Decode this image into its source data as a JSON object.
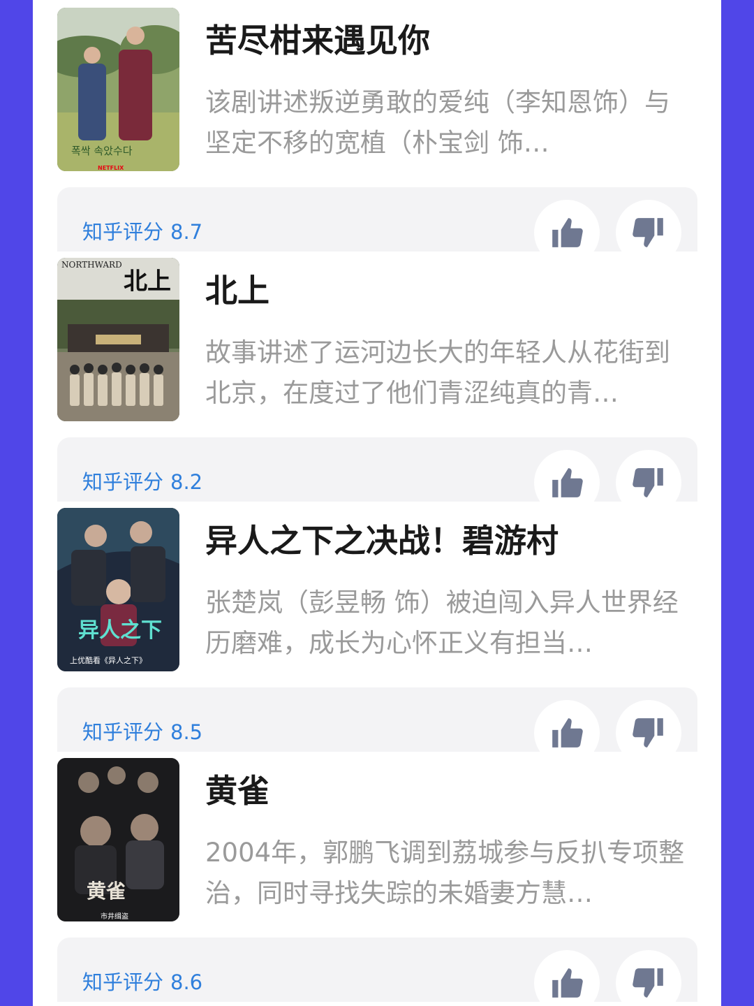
{
  "colors": {
    "background": "#5046e8",
    "panel": "#ffffff",
    "rating": "#2f7fdc",
    "vote_icon": "#6f7891"
  },
  "icons": {
    "upvote": "thumbs-up-icon",
    "downvote": "thumbs-down-icon"
  },
  "items": [
    {
      "title": "苦尽柑来遇见你",
      "description": "该剧讲述叛逆勇敢的爱纯（李知恩饰）与坚定不移的宽植（朴宝剑 饰…",
      "rating_label": "知乎评分",
      "rating_value": "8.7",
      "poster_text": "폭싹 속았수다",
      "poster_badge": "NETFLIX"
    },
    {
      "title": "北上",
      "description": "故事讲述了运河边长大的年轻人从花街到北京，在度过了他们青涩纯真的青…",
      "rating_label": "知乎评分",
      "rating_value": "8.2",
      "poster_text": "北上",
      "poster_badge": "NORTHWARD"
    },
    {
      "title": "异人之下之决战！碧游村",
      "description": "张楚岚（彭昱畅 饰）被迫闯入异人世界经历磨难，成长为心怀正义有担当…",
      "rating_label": "知乎评分",
      "rating_value": "8.5",
      "poster_text": "异人之下",
      "poster_badge": "上优酷看《异人之下》"
    },
    {
      "title": "黄雀",
      "description": "2004年，郭鹏飞调到荔城参与反扒专项整治，同时寻找失踪的未婚妻方慧…",
      "rating_label": "知乎评分",
      "rating_value": "8.6",
      "poster_text": "黄雀",
      "poster_badge": "市井缉盗"
    }
  ]
}
